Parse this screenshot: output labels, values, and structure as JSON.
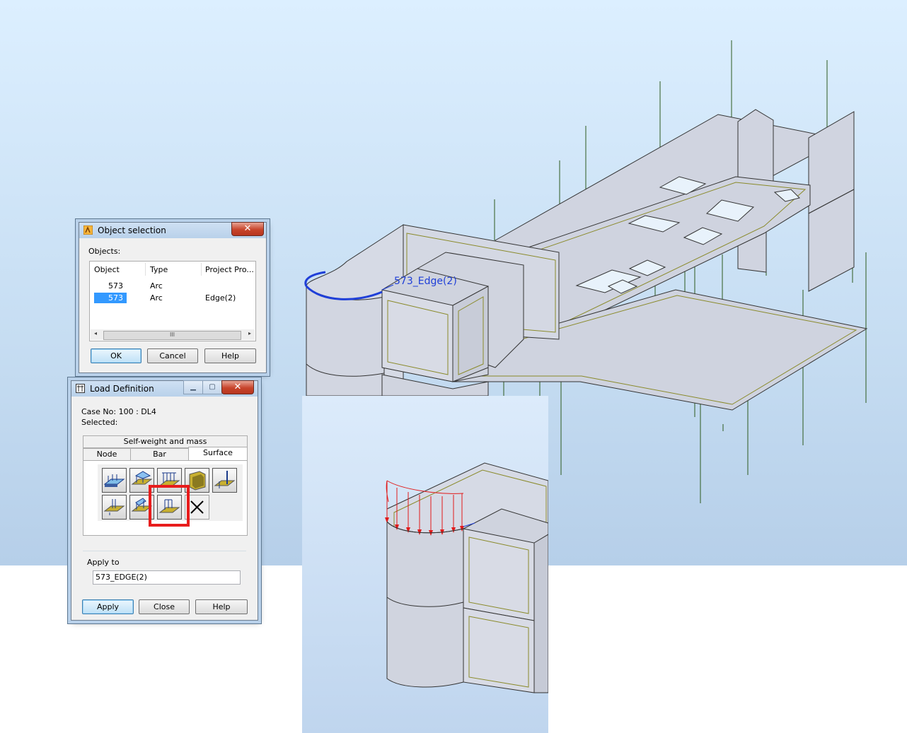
{
  "viewport": {
    "edge_label": "573_Edge(2)"
  },
  "object_selection": {
    "title": "Object selection",
    "close_glyph": "✕",
    "objects_label": "Objects:",
    "columns": [
      "Object",
      "Type",
      "Project Pro..."
    ],
    "rows": [
      {
        "object": "573",
        "type": "Arc",
        "project": ""
      },
      {
        "object": "573",
        "type": "Arc",
        "project": "Edge(2)",
        "selected": true
      }
    ],
    "scroll_thumb_label": "III",
    "scroll_left": "◂",
    "scroll_right": "▸",
    "buttons": {
      "ok": "OK",
      "cancel": "Cancel",
      "help": "Help"
    }
  },
  "load_definition": {
    "title": "Load Definition",
    "close_glyph": "✕",
    "minimize_glyph": "▁",
    "maximize_glyph": "▢",
    "case_no": "Case No: 100 : DL4",
    "selected_label": "Selected:",
    "tabs": {
      "self_weight": "Self-weight and mass",
      "node": "Node",
      "bar": "Bar",
      "surface": "Surface"
    },
    "tools": [
      "uniform-planar-load-icon",
      "planar-load-3-points-icon",
      "planar-load-contour-icon",
      "hydrostatic-pressure-icon",
      "thermal-load-icon",
      "linear-load-on-edges-icon",
      "linear-load-2p-icon",
      "edge-load-icon",
      "delete-load-icon"
    ],
    "apply_to_label": "Apply to",
    "apply_to_value": "573_EDGE(2)",
    "buttons": {
      "apply": "Apply",
      "close": "Close",
      "help": "Help"
    }
  },
  "colors": {
    "selection_arc": "#1f3fd8",
    "load_arrows": "#e11b1b",
    "highlight_box": "#e81c1c",
    "node_lines": "#2d5a1e",
    "panel_outline": "#8a8a2a"
  }
}
